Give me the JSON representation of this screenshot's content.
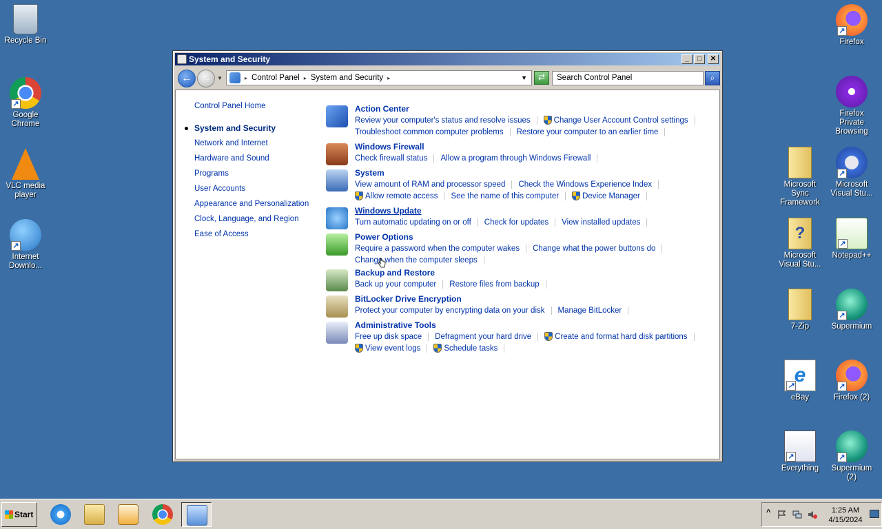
{
  "desktop": {
    "icons_left": [
      {
        "label": "Recycle Bin"
      },
      {
        "label": "Google Chrome"
      },
      {
        "label": "VLC media player"
      },
      {
        "label": "Internet Downlo..."
      }
    ],
    "icons_right": [
      {
        "label": "Firefox"
      },
      {
        "label": "Firefox Private Browsing"
      },
      {
        "label": "Microsoft Sync Framework"
      },
      {
        "label": "Microsoft Visual Stu..."
      },
      {
        "label": "Microsoft Visual Stu..."
      },
      {
        "label": "Notepad++"
      },
      {
        "label": "7-Zip"
      },
      {
        "label": "Supermium"
      },
      {
        "label": "eBay"
      },
      {
        "label": "Firefox (2)"
      },
      {
        "label": "Everything"
      },
      {
        "label": "Supermium (2)"
      }
    ]
  },
  "window": {
    "title": "System and Security",
    "buttons": {
      "minimize": "_",
      "maximize": "□",
      "close": "✕"
    },
    "breadcrumb": [
      "Control Panel",
      "System and Security"
    ],
    "search_placeholder": "Search Control Panel"
  },
  "leftnav": {
    "home": "Control Panel Home",
    "items": [
      {
        "label": "System and Security",
        "active": true
      },
      {
        "label": "Network and Internet"
      },
      {
        "label": "Hardware and Sound"
      },
      {
        "label": "Programs"
      },
      {
        "label": "User Accounts"
      },
      {
        "label": "Appearance and Personalization"
      },
      {
        "label": "Clock, Language, and Region"
      },
      {
        "label": "Ease of Access"
      }
    ]
  },
  "categories": [
    {
      "title": "Action Center",
      "icon": "flag-icon",
      "lines": [
        [
          {
            "text": "Review your computer's status and resolve issues"
          },
          {
            "text": "Change User Account Control settings",
            "shield": true
          }
        ],
        [
          {
            "text": "Troubleshoot common computer problems"
          },
          {
            "text": "Restore your computer to an earlier time"
          }
        ]
      ]
    },
    {
      "title": "Windows Firewall",
      "icon": "firewall-icon",
      "lines": [
        [
          {
            "text": "Check firewall status"
          },
          {
            "text": "Allow a program through Windows Firewall"
          }
        ]
      ]
    },
    {
      "title": "System",
      "icon": "computer-icon",
      "lines": [
        [
          {
            "text": "View amount of RAM and processor speed"
          },
          {
            "text": "Check the Windows Experience Index"
          }
        ],
        [
          {
            "text": "Allow remote access",
            "shield": true
          },
          {
            "text": "See the name of this computer"
          },
          {
            "text": "Device Manager",
            "shield": true
          }
        ]
      ]
    },
    {
      "title": "Windows Update",
      "icon": "windows-update-icon",
      "lines": [
        [
          {
            "text": "Turn automatic updating on or off"
          },
          {
            "text": "Check for updates"
          },
          {
            "text": "View installed updates"
          }
        ]
      ]
    },
    {
      "title": "Power Options",
      "icon": "battery-icon",
      "lines": [
        [
          {
            "text": "Require a password when the computer wakes"
          },
          {
            "text": "Change what the power buttons do"
          }
        ],
        [
          {
            "text": "Change when the computer sleeps"
          }
        ]
      ]
    },
    {
      "title": "Backup and Restore",
      "icon": "backup-icon",
      "lines": [
        [
          {
            "text": "Back up your computer"
          },
          {
            "text": "Restore files from backup"
          }
        ]
      ]
    },
    {
      "title": "BitLocker Drive Encryption",
      "icon": "bitlocker-icon",
      "lines": [
        [
          {
            "text": "Protect your computer by encrypting data on your disk"
          },
          {
            "text": "Manage BitLocker"
          }
        ]
      ]
    },
    {
      "title": "Administrative Tools",
      "icon": "admin-tools-icon",
      "lines": [
        [
          {
            "text": "Free up disk space"
          },
          {
            "text": "Defragment your hard drive"
          },
          {
            "text": "Create and format hard disk partitions",
            "shield": true
          }
        ],
        [
          {
            "text": "View event logs",
            "shield": true
          },
          {
            "text": "Schedule tasks",
            "shield": true
          }
        ]
      ]
    }
  ],
  "taskbar": {
    "start_label": "Start",
    "clock_time": "1:25 AM",
    "clock_date": "4/15/2024",
    "tray_chevron": "^"
  }
}
